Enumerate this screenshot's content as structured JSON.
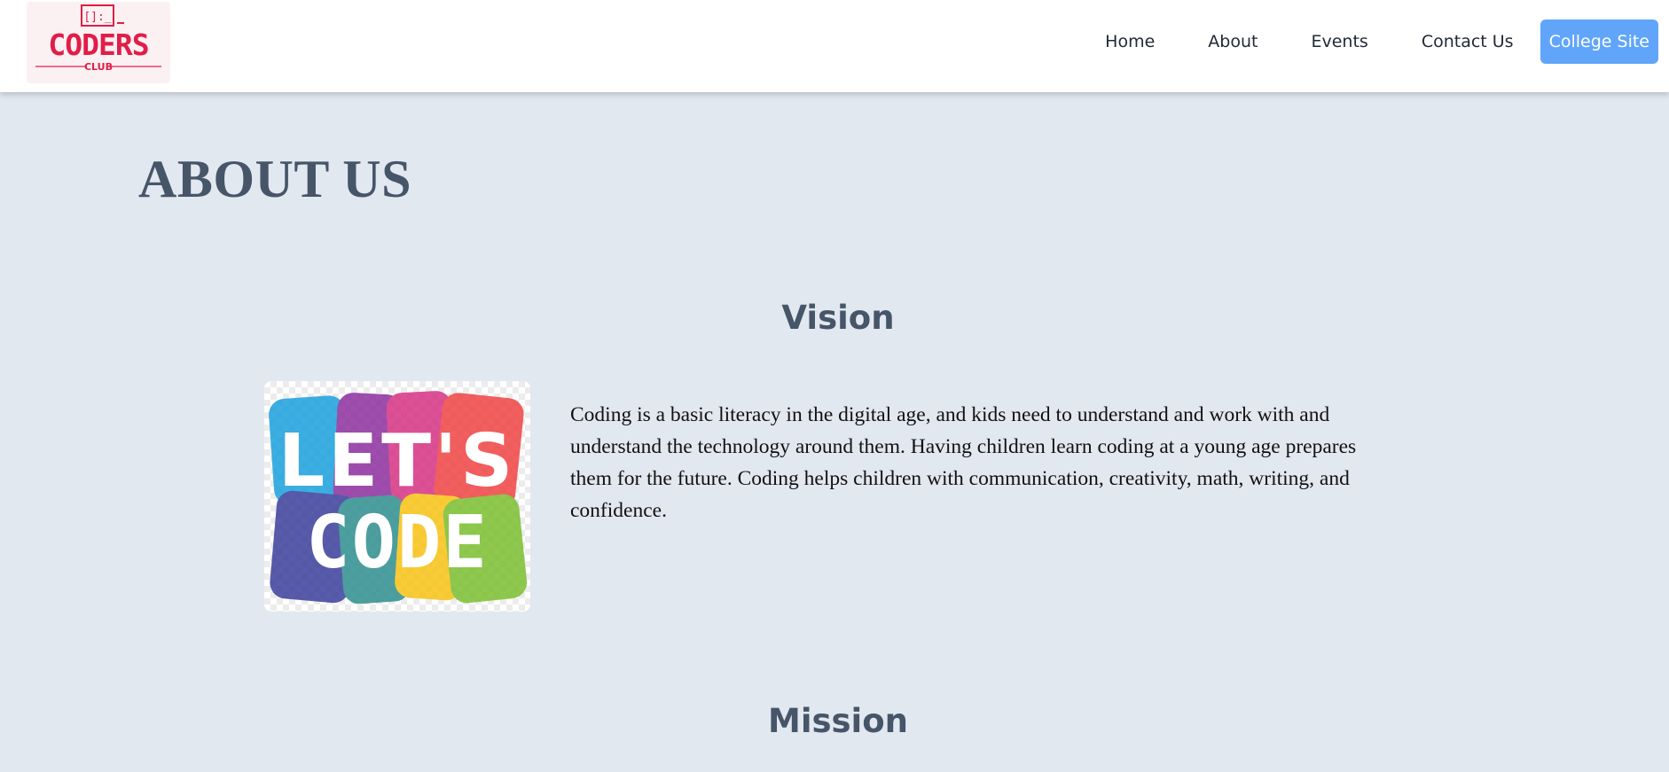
{
  "nav": {
    "logo": {
      "line1": "CODERS",
      "line2": "CLUB",
      "glyph": "[]:_"
    },
    "links": [
      "Home",
      "About",
      "Events",
      "Contact Us"
    ],
    "cta_label": "College Site"
  },
  "page": {
    "title": "ABOUT US"
  },
  "vision": {
    "heading": "Vision",
    "image_text": {
      "line1": "LET'S",
      "line2": "CODE"
    },
    "text": "Coding is a basic literacy in the digital age, and kids need to understand and work with and understand the technology around them. Having children learn coding at a young age prepares them for the future. Coding helps children with communication, creativity, math, writing, and confidence."
  },
  "mission": {
    "heading": "Mission"
  },
  "colors": {
    "background": "#e2e8f0",
    "navbar": "#ffffff",
    "accent": "#60a5fa",
    "heading": "#475569",
    "logo_red": "#e11d48"
  }
}
